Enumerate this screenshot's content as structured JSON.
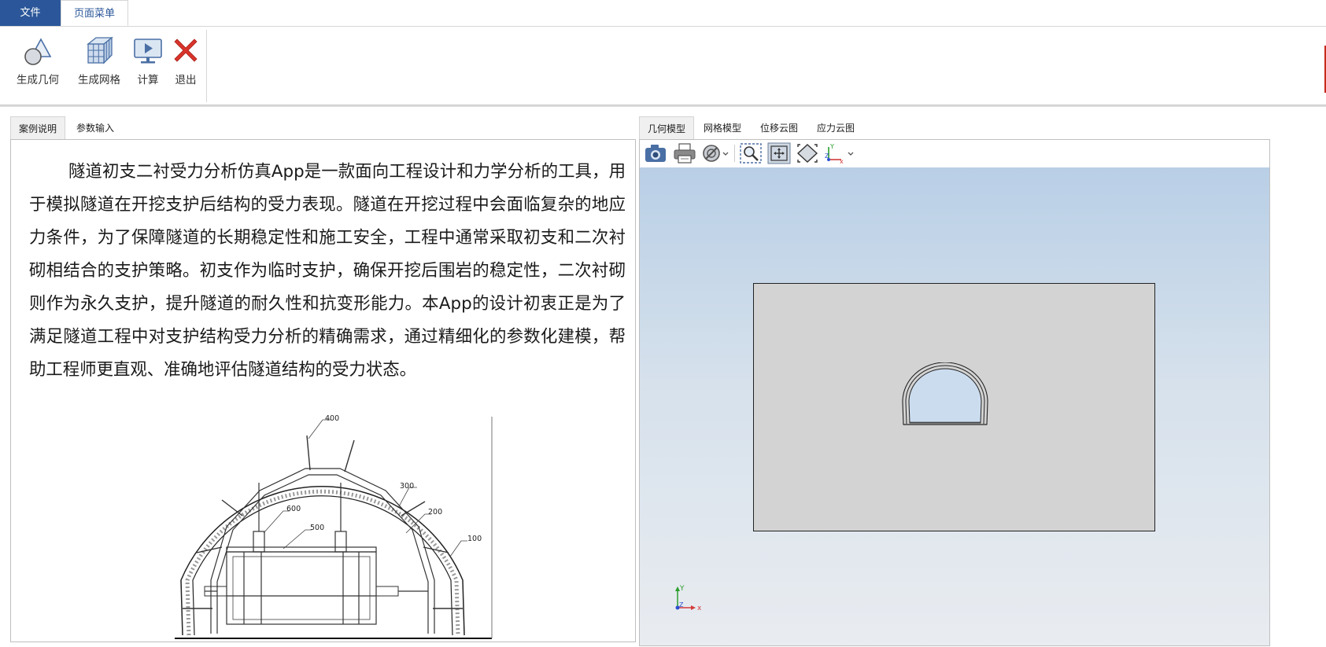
{
  "ribbon": {
    "tabs": {
      "file": "文件",
      "page_menu": "页面菜单"
    },
    "buttons": {
      "gen_geometry": "生成几何",
      "gen_mesh": "生成网格",
      "compute": "计算",
      "exit": "退出"
    }
  },
  "left_panel": {
    "tabs": {
      "description": "案例说明",
      "parameters": "参数输入"
    },
    "description": "隧道初支二衬受力分析仿真App是一款面向工程设计和力学分析的工具，用于模拟隧道在开挖支护后结构的受力表现。隧道在开挖过程中会面临复杂的地应力条件，为了保障隧道的长期稳定性和施工安全，工程中通常采取初支和二次衬砌相结合的支护策略。初支作为临时支护，确保开挖后围岩的稳定性，二次衬砌则作为永久支护，提升隧道的耐久性和抗变形能力。本App的设计初衷正是为了满足隧道工程中对支护结构受力分析的精确需求，通过精细化的参数化建模，帮助工程师更直观、准确地评估隧道结构的受力状态。",
    "figure_labels": [
      "400",
      "300",
      "600",
      "500",
      "200",
      "100"
    ]
  },
  "right_panel": {
    "tabs": {
      "geometry": "几何模型",
      "mesh": "网格模型",
      "displacement": "位移云图",
      "stress": "应力云图"
    },
    "toolbar_icons": [
      "camera-icon",
      "print-icon",
      "render-mode-icon",
      "zoom-box-icon",
      "zoom-fit-icon",
      "view-fit-icon",
      "axis-view-icon"
    ],
    "axis_labels": {
      "x": "x",
      "y": "Y",
      "z": "Z"
    }
  },
  "colors": {
    "ribbon_accent": "#2b579a",
    "exit_red": "#d9342b",
    "geometry_fill": "#d3d3d3",
    "viewport_top": "#b9cfe6",
    "viewport_bottom": "#e9ecf0"
  }
}
